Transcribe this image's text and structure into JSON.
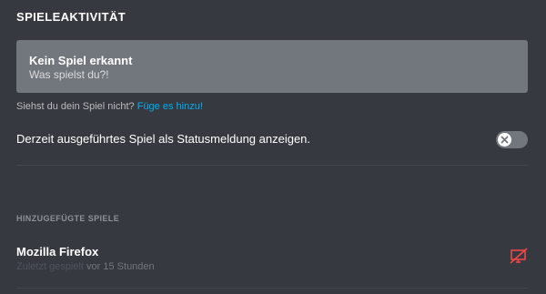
{
  "section": {
    "title": "SPIELEAKTIVITÄT"
  },
  "game_box": {
    "title": "Kein Spiel erkannt",
    "subtitle": "Was spielst du?!"
  },
  "hint": {
    "text": "Siehst du dein Spiel nicht?",
    "link": "Füge es hinzu!"
  },
  "status_setting": {
    "label": "Derzeit ausgeführtes Spiel als Statusmeldung anzeigen.",
    "enabled": false
  },
  "added_games": {
    "title": "HINZUGEFÜGTE SPIELE",
    "items": [
      {
        "name": "Mozilla Firefox",
        "played_prefix": "Zuletzt gespielt",
        "played_time": "vor 15 Stunden",
        "overlay_icon": "overlay-disabled-icon"
      }
    ]
  },
  "colors": {
    "background": "#36393f",
    "box": "#72767d",
    "link": "#00b0f4",
    "danger": "#f04747"
  }
}
